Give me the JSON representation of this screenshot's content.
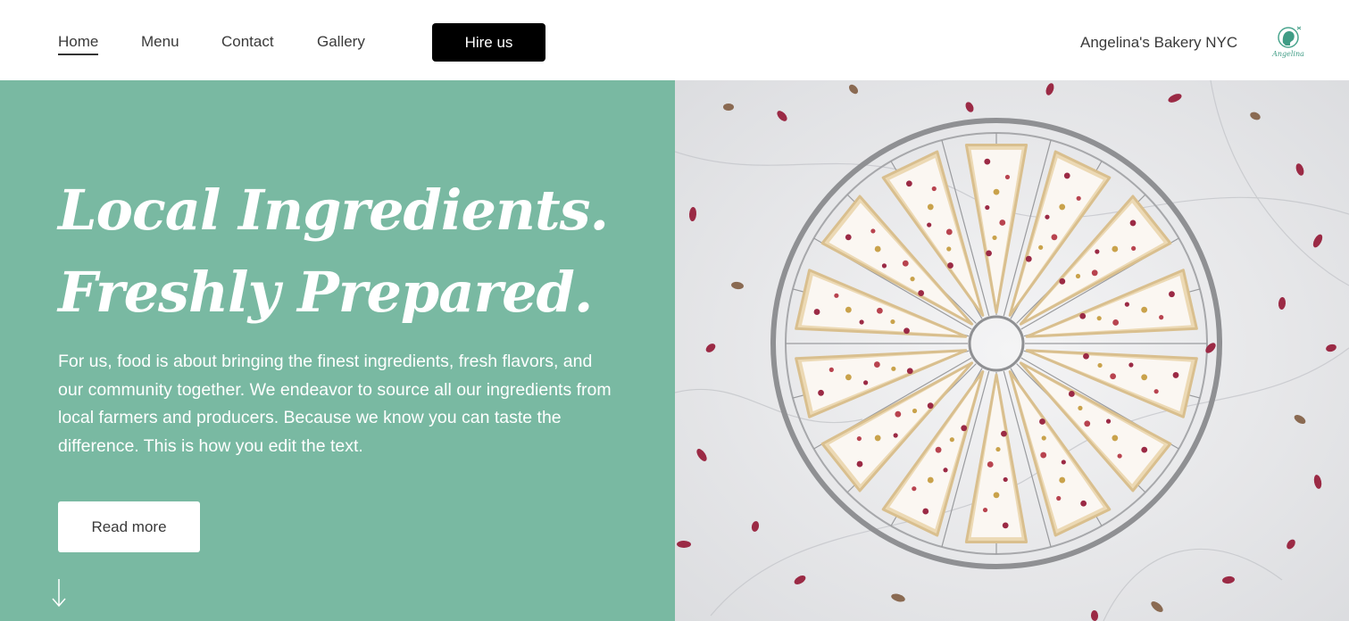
{
  "nav": {
    "items": [
      {
        "label": "Home",
        "active": true
      },
      {
        "label": "Menu",
        "active": false
      },
      {
        "label": "Contact",
        "active": false
      },
      {
        "label": "Gallery",
        "active": false
      }
    ],
    "cta_label": "Hire us"
  },
  "brand": {
    "name": "Angelina's Bakery NYC",
    "logo_text": "Angelina",
    "logo_icon": "angelina-logo-icon"
  },
  "hero": {
    "headline_line1": "Local Ingredients.",
    "headline_line2": "Freshly Prepared.",
    "body": "For us, food is about bringing the finest ingredients, fresh flavors, and our community together. We endeavor to source all our ingredients from local farmers and producers. Because we know you can taste the difference. This is how you edit the text.",
    "button_label": "Read more",
    "scroll_icon": "arrow-down-icon",
    "image_icon": "cake-photo"
  },
  "colors": {
    "accent": "#79b9a2",
    "cta": "#000000",
    "text": "#3a3a3a"
  }
}
